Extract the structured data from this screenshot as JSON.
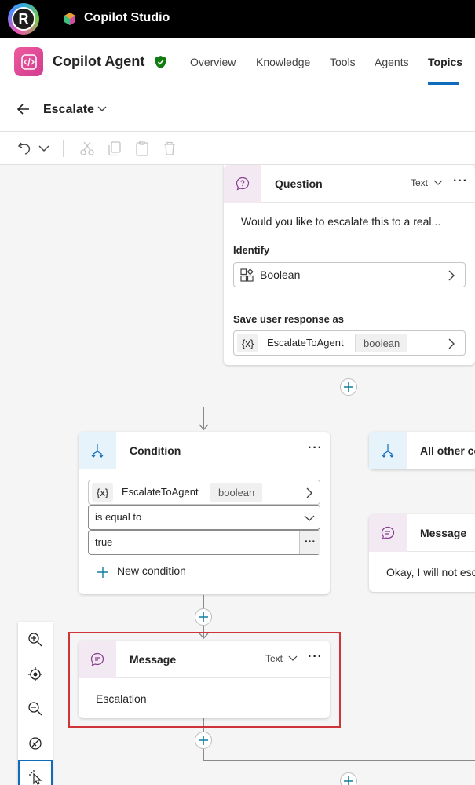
{
  "app": {
    "title": "Copilot Studio",
    "avatar_letter": "R"
  },
  "agent": {
    "name": "Copilot Agent"
  },
  "nav": {
    "tabs": [
      "Overview",
      "Knowledge",
      "Tools",
      "Agents",
      "Topics"
    ],
    "active": "Topics"
  },
  "topic": {
    "name": "Escalate"
  },
  "question_node": {
    "title": "Question",
    "type_label": "Text",
    "prompt": "Would you like to escalate this to a real...",
    "identify_label": "Identify",
    "identify_value": "Boolean",
    "save_label": "Save user response as",
    "variable_icon": "{x}",
    "variable_name": "EscalateToAgent",
    "variable_type": "boolean"
  },
  "condition_node": {
    "title": "Condition",
    "variable_icon": "{x}",
    "variable_name": "EscalateToAgent",
    "variable_type": "boolean",
    "operator": "is equal to",
    "value": "true",
    "new_condition": "New condition"
  },
  "other_condition_node": {
    "title": "All other co"
  },
  "message_node_right": {
    "title": "Message",
    "text": "Okay, I will not esc"
  },
  "message_node": {
    "title": "Message",
    "type_label": "Text",
    "text": "Escalation"
  },
  "colors": {
    "accent": "#0f6cbd",
    "highlight": "#d13438",
    "agent_icon": "#e6529b",
    "verified": "#107c10"
  }
}
